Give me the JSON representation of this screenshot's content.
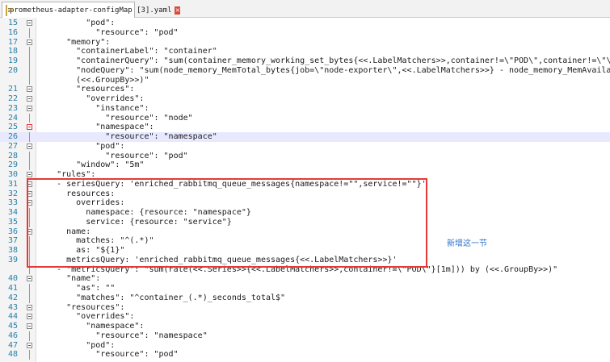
{
  "tab": {
    "label": "prometheus-adapter-configMap [3].yaml",
    "close": "×"
  },
  "annotation": "新增这一节",
  "lines": [
    {
      "n": "15",
      "t": "          \"pod\":",
      "f": "minus"
    },
    {
      "n": "16",
      "t": "            \"resource\": \"pod\"",
      "f": ""
    },
    {
      "n": "17",
      "t": "      \"memory\":",
      "f": "minus"
    },
    {
      "n": "18",
      "t": "        \"containerLabel\": \"container\"",
      "f": ""
    },
    {
      "n": "19",
      "t": "        \"containerQuery\": \"sum(container_memory_working_set_bytes{<<.LabelMatchers>>,container!=\\\"POD\\\",container!=\\\"\\\",po",
      "f": ""
    },
    {
      "n": "20",
      "t": "        \"nodeQuery\": \"sum(node_memory_MemTotal_bytes{job=\\\"node-exporter\\\",<<.LabelMatchers>>} - node_memory_MemAvailable_",
      "f": ""
    },
    {
      "n": "",
      "t": "        (<<.GroupBy>>)\"",
      "f": ""
    },
    {
      "n": "21",
      "t": "        \"resources\":",
      "f": "minus"
    },
    {
      "n": "22",
      "t": "          \"overrides\":",
      "f": "minus"
    },
    {
      "n": "23",
      "t": "            \"instance\":",
      "f": "minus"
    },
    {
      "n": "24",
      "t": "              \"resource\": \"node\"",
      "f": ""
    },
    {
      "n": "25",
      "t": "            \"namespace\":",
      "f": "red"
    },
    {
      "n": "26",
      "t": "              \"resource\": \"namespace\"",
      "f": "",
      "hl": true
    },
    {
      "n": "27",
      "t": "            \"pod\":",
      "f": "minus"
    },
    {
      "n": "28",
      "t": "              \"resource\": \"pod\"",
      "f": ""
    },
    {
      "n": "29",
      "t": "        \"window\": \"5m\"",
      "f": ""
    },
    {
      "n": "30",
      "t": "    \"rules\":",
      "f": "minus"
    },
    {
      "n": "31",
      "t": "    - seriesQuery: 'enriched_rabbitmq_queue_messages{namespace!=\"\",service!=\"\"}'",
      "f": "minus"
    },
    {
      "n": "32",
      "t": "      resources:",
      "f": "minus"
    },
    {
      "n": "33",
      "t": "        overrides:",
      "f": "minus"
    },
    {
      "n": "34",
      "t": "          namespace: {resource: \"namespace\"}",
      "f": ""
    },
    {
      "n": "35",
      "t": "          service: {resource: \"service\"}",
      "f": ""
    },
    {
      "n": "36",
      "t": "      name:",
      "f": "minus"
    },
    {
      "n": "37",
      "t": "        matches: \"^(.*)\"",
      "f": ""
    },
    {
      "n": "38",
      "t": "        as: \"${1}\"",
      "f": ""
    },
    {
      "n": "39",
      "t": "      metricsQuery: 'enriched_rabbitmq_queue_messages{<<.LabelMatchers>>}'",
      "f": ""
    },
    {
      "n": "",
      "t": "    - \"metricsQuery\": \"sum(rate(<<.Series>>{<<.LabelMatchers>>,container!=\\\"POD\\\"}[1m])) by (<<.GroupBy>>)\"",
      "f": ""
    },
    {
      "n": "40",
      "t": "      \"name\":",
      "f": "minus"
    },
    {
      "n": "41",
      "t": "        \"as\": \"\"",
      "f": ""
    },
    {
      "n": "42",
      "t": "        \"matches\": \"^container_(.*)_seconds_total$\"",
      "f": ""
    },
    {
      "n": "43",
      "t": "      \"resources\":",
      "f": "minus"
    },
    {
      "n": "44",
      "t": "        \"overrides\":",
      "f": "minus"
    },
    {
      "n": "45",
      "t": "          \"namespace\":",
      "f": "minus"
    },
    {
      "n": "46",
      "t": "            \"resource\": \"namespace\"",
      "f": ""
    },
    {
      "n": "47",
      "t": "          \"pod\":",
      "f": "minus"
    },
    {
      "n": "48",
      "t": "            \"resource\": \"pod\"",
      "f": ""
    }
  ]
}
